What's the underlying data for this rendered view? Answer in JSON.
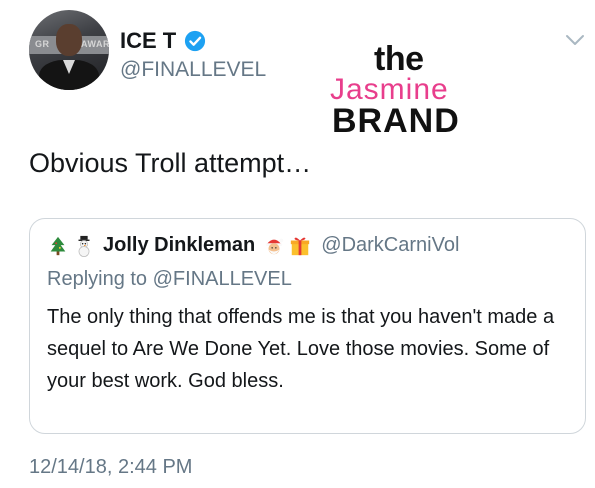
{
  "tweet": {
    "author_name": "ICE T",
    "author_handle": "@FINALLEVEL",
    "text": "Obvious Troll attempt…",
    "timestamp": "12/14/18, 2:44 PM",
    "verified": true
  },
  "avatar": {
    "backdrop_left": "GR",
    "backdrop_right": "AWAR"
  },
  "watermark": {
    "line1": "the",
    "line2": "Jasmine",
    "line3": "BRAND",
    "accent_color": "#e83e8c"
  },
  "quoted_tweet": {
    "author_name": "Jolly Dinkleman",
    "author_handle": "@DarkCarniVol",
    "replying_to": "Replying to @FINALLEVEL",
    "text": "The only thing that offends me is that you haven't made a sequel to Are We Done Yet. Love those movies. Some of your best work. God bless.",
    "name_emojis_before": [
      "tree-emoji",
      "snowman-emoji"
    ],
    "name_emojis_after": [
      "santa-emoji",
      "gift-emoji"
    ]
  },
  "colors": {
    "text_primary": "#14171a",
    "text_secondary": "#657786",
    "verified_blue": "#1da1f2",
    "border": "#d0d6db"
  }
}
